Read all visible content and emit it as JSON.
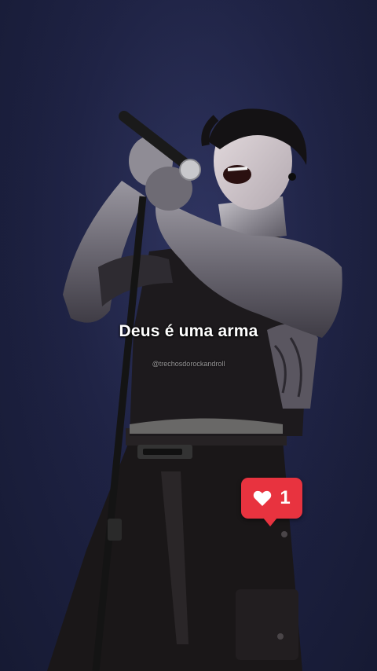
{
  "caption": {
    "text": "Deus é uma arma"
  },
  "watermark": {
    "text": "@trechosdorockandroll"
  },
  "like_badge": {
    "icon": "heart-icon",
    "count": "1",
    "color": "#e8333f"
  },
  "colors": {
    "background": "#1e2244",
    "caption_text": "#ffffff"
  }
}
